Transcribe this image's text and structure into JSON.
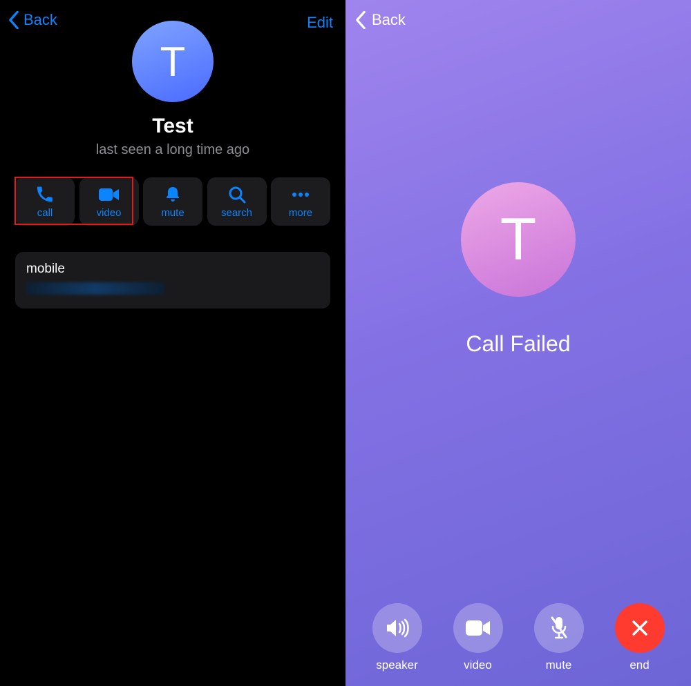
{
  "left": {
    "back": "Back",
    "edit": "Edit",
    "avatar_letter": "T",
    "contact_name": "Test",
    "last_seen": "last seen a long time ago",
    "actions": {
      "call": "call",
      "video": "video",
      "mute": "mute",
      "search": "search",
      "more": "more"
    },
    "info": {
      "label": "mobile"
    }
  },
  "right": {
    "back": "Back",
    "avatar_letter": "T",
    "status": "Call Failed",
    "controls": {
      "speaker": "speaker",
      "video": "video",
      "mute": "mute",
      "end": "end"
    }
  }
}
